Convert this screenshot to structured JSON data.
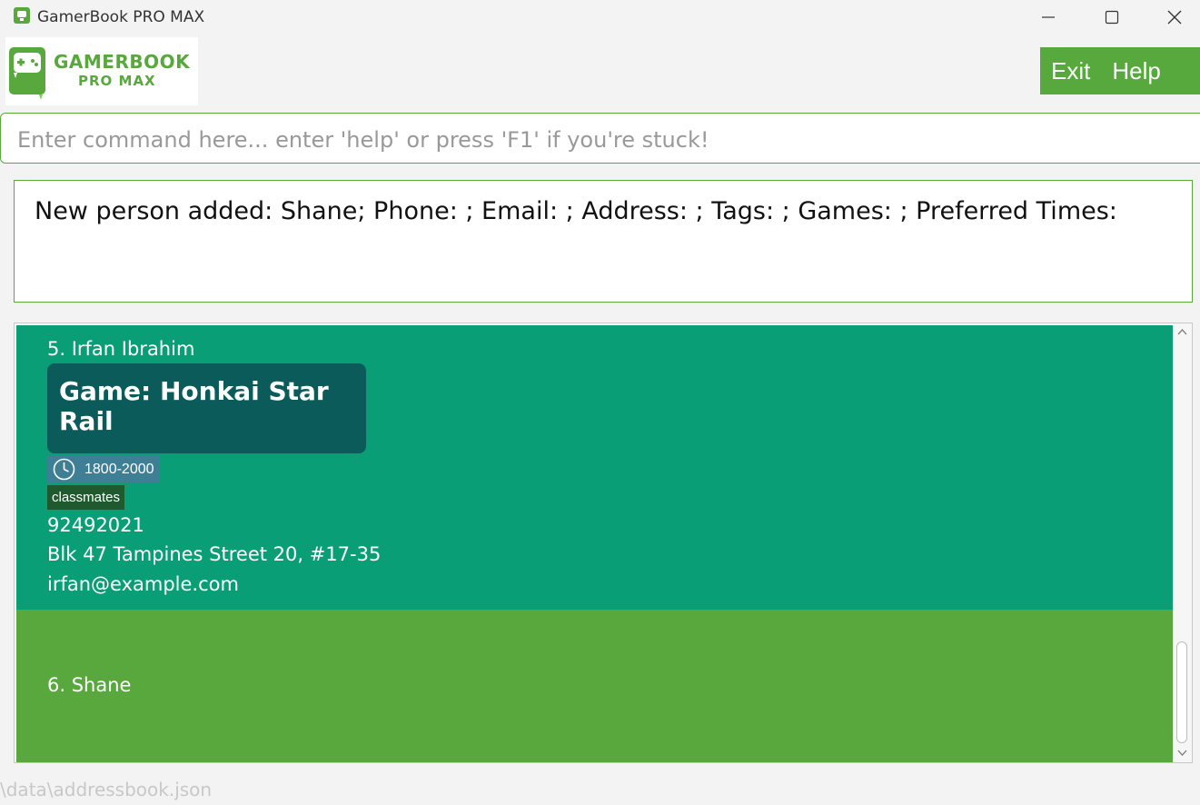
{
  "window": {
    "title": "GamerBook PRO MAX"
  },
  "logo": {
    "title": "GAMERBOOK",
    "subtitle": "PRO MAX"
  },
  "menu": {
    "exit_label": "Exit",
    "help_label": "Help"
  },
  "command": {
    "value": "",
    "placeholder": "Enter command here... enter 'help' or press 'F1' if you're stuck!"
  },
  "result": {
    "text": "New person added: Shane; Phone: ; Email: ; Address: ; Tags: ; Games: ; Preferred Times:"
  },
  "persons": [
    {
      "index_name": "5. Irfan Ibrahim",
      "game": "Game: Honkai Star Rail",
      "preferred_time": "1800-2000",
      "tag": "classmates",
      "phone": "92492021",
      "address": "Blk 47 Tampines Street 20, #17-35",
      "email": "irfan@example.com"
    },
    {
      "index_name": "6. Shane"
    }
  ],
  "status": {
    "path": "\\data\\addressbook.json"
  },
  "colors": {
    "brand_green": "#58a83d",
    "card_teal": "#0a9e77",
    "game_card": "#0b5b5a",
    "time_chip": "#3f7f95",
    "tag_chip": "#1e5a2e"
  },
  "icons": [
    "app-icon",
    "minimize-icon",
    "maximize-icon",
    "close-icon",
    "clock-icon",
    "chevron-up-icon",
    "chevron-down-icon"
  ]
}
